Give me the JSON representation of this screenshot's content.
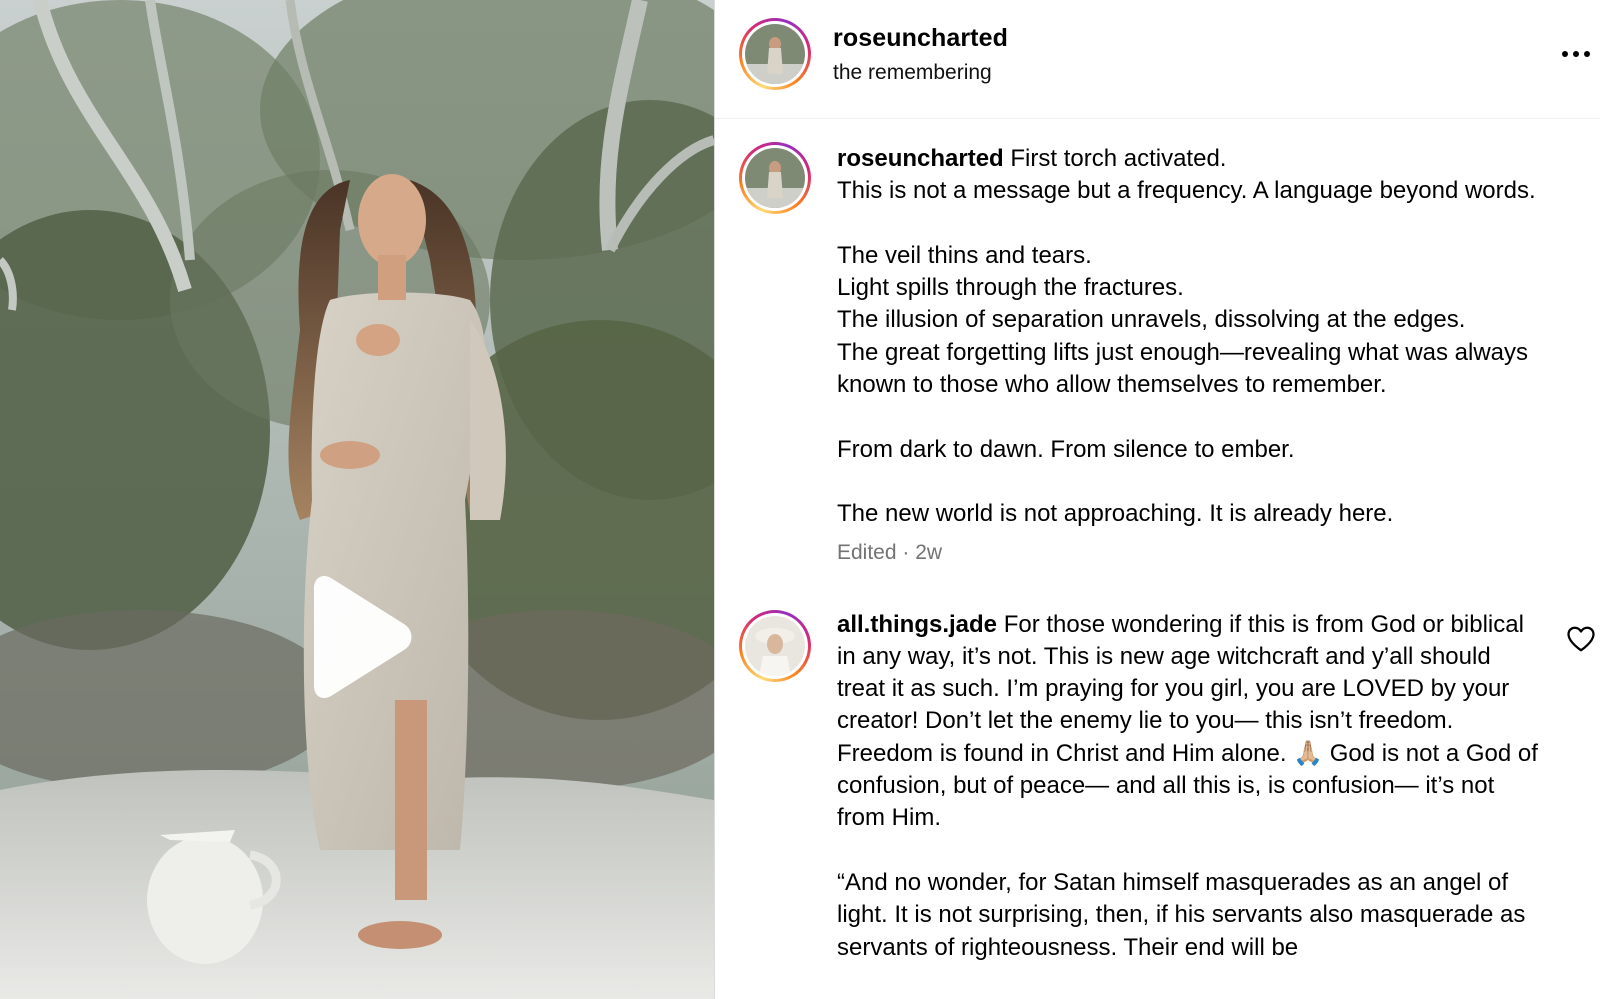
{
  "post": {
    "username": "roseuncharted",
    "audio_title": "the remembering"
  },
  "caption": {
    "username": "roseuncharted",
    "text": " First torch activated.\nThis is not a message but a frequency. A language beyond words.\n\nThe veil thins and tears.\nLight spills through the fractures.\nThe illusion of separation unravels, dissolving at the edges.\nThe great forgetting lifts just enough—revealing what was always known to those who allow themselves to remember.\n\nFrom dark to dawn. From silence to ember.\n\nThe new world is not approaching. It is already here.",
    "meta": "Edited · 2w"
  },
  "comments": [
    {
      "username": "all.things.jade",
      "text": " For those wondering if this is from God or biblical in any way, it’s not. This is new age witchcraft and y’all should treat it as such. I’m praying for you girl, you are LOVED by your creator! Don’t let the enemy lie to you— this isn’t freedom. Freedom is found in Christ and Him alone. 🙏🏼 God is not a God of confusion, but of peace— and all this is, is confusion— it’s not from Him.\n\n“And no wonder, for Satan himself masquerades as an angel of light. It is not surprising, then, if his servants also masquerade as servants of righteousness. Their end will be"
    }
  ],
  "icons": {
    "play": "play-icon",
    "more": "more-options-icon",
    "like": "heart-icon"
  },
  "colors": {
    "ring_start": "#feda75",
    "ring_mid": "#d62976",
    "ring_end": "#962fbf",
    "meta_text": "#737373",
    "divider": "#dbdbdb"
  }
}
